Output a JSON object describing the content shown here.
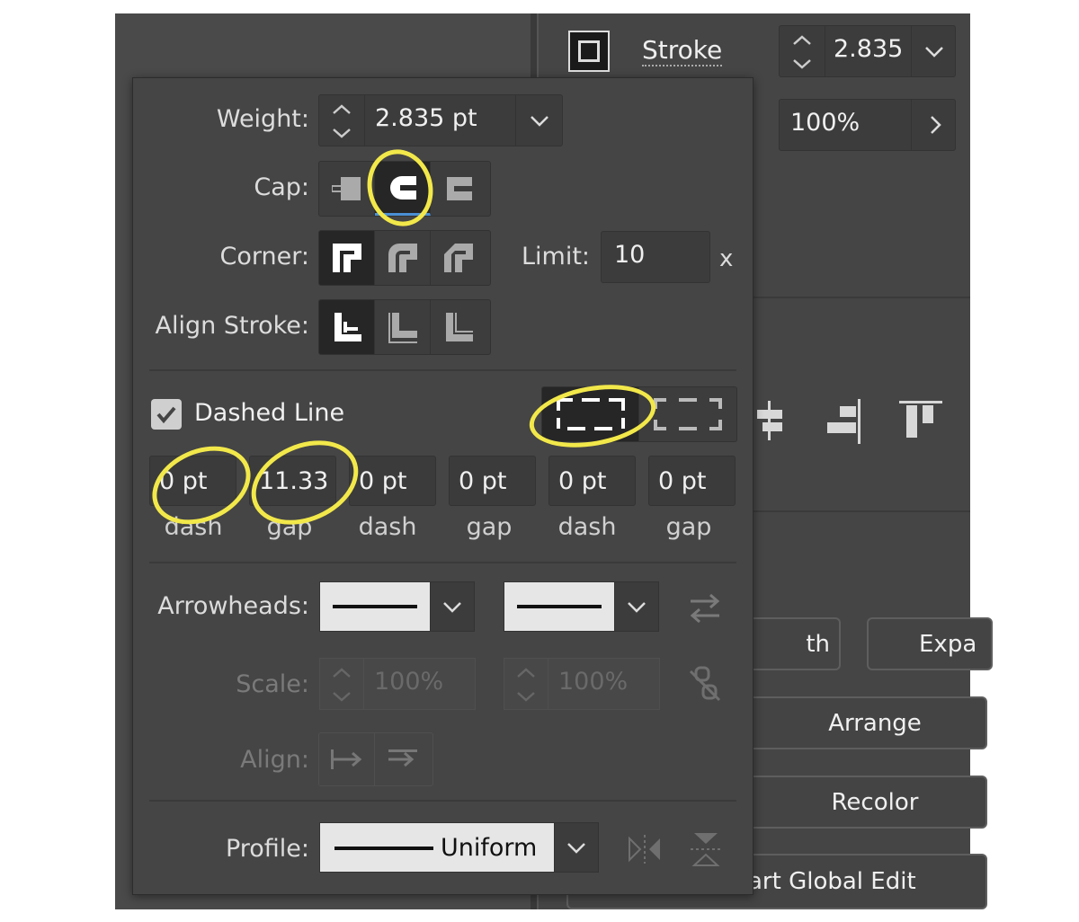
{
  "bg_panel": {
    "stroke_label": "Stroke",
    "stroke_value": "2.835",
    "opacity_value": "100%",
    "btn_path_partial": "th",
    "btn_expand_partial": "Expa",
    "arrange_label": "Arrange",
    "recolor_label": "Recolor",
    "global_edit_partial": "art Global Edit"
  },
  "stroke_popup": {
    "weight_label": "Weight:",
    "weight_value": "2.835 pt",
    "cap_label": "Cap:",
    "corner_label": "Corner:",
    "limit_label": "Limit:",
    "limit_value": "10",
    "limit_unit": "x",
    "align_stroke_label": "Align Stroke:",
    "dashed_line_label": "Dashed Line",
    "dashed_line_checked": true,
    "dash_fields": [
      {
        "value": "0 pt",
        "label": "dash"
      },
      {
        "value": "11.33",
        "label": "gap"
      },
      {
        "value": "0 pt",
        "label": "dash"
      },
      {
        "value": "0 pt",
        "label": "gap"
      },
      {
        "value": "0 pt",
        "label": "dash"
      },
      {
        "value": "0 pt",
        "label": "gap"
      }
    ],
    "arrowheads_label": "Arrowheads:",
    "scale_label": "Scale:",
    "scale_start": "100%",
    "scale_end": "100%",
    "align_label": "Align:",
    "profile_label": "Profile:",
    "profile_value": "Uniform"
  },
  "colors": {
    "highlight": "#f2e84a",
    "panel_bg": "#454545",
    "selected_button": "#262626"
  }
}
